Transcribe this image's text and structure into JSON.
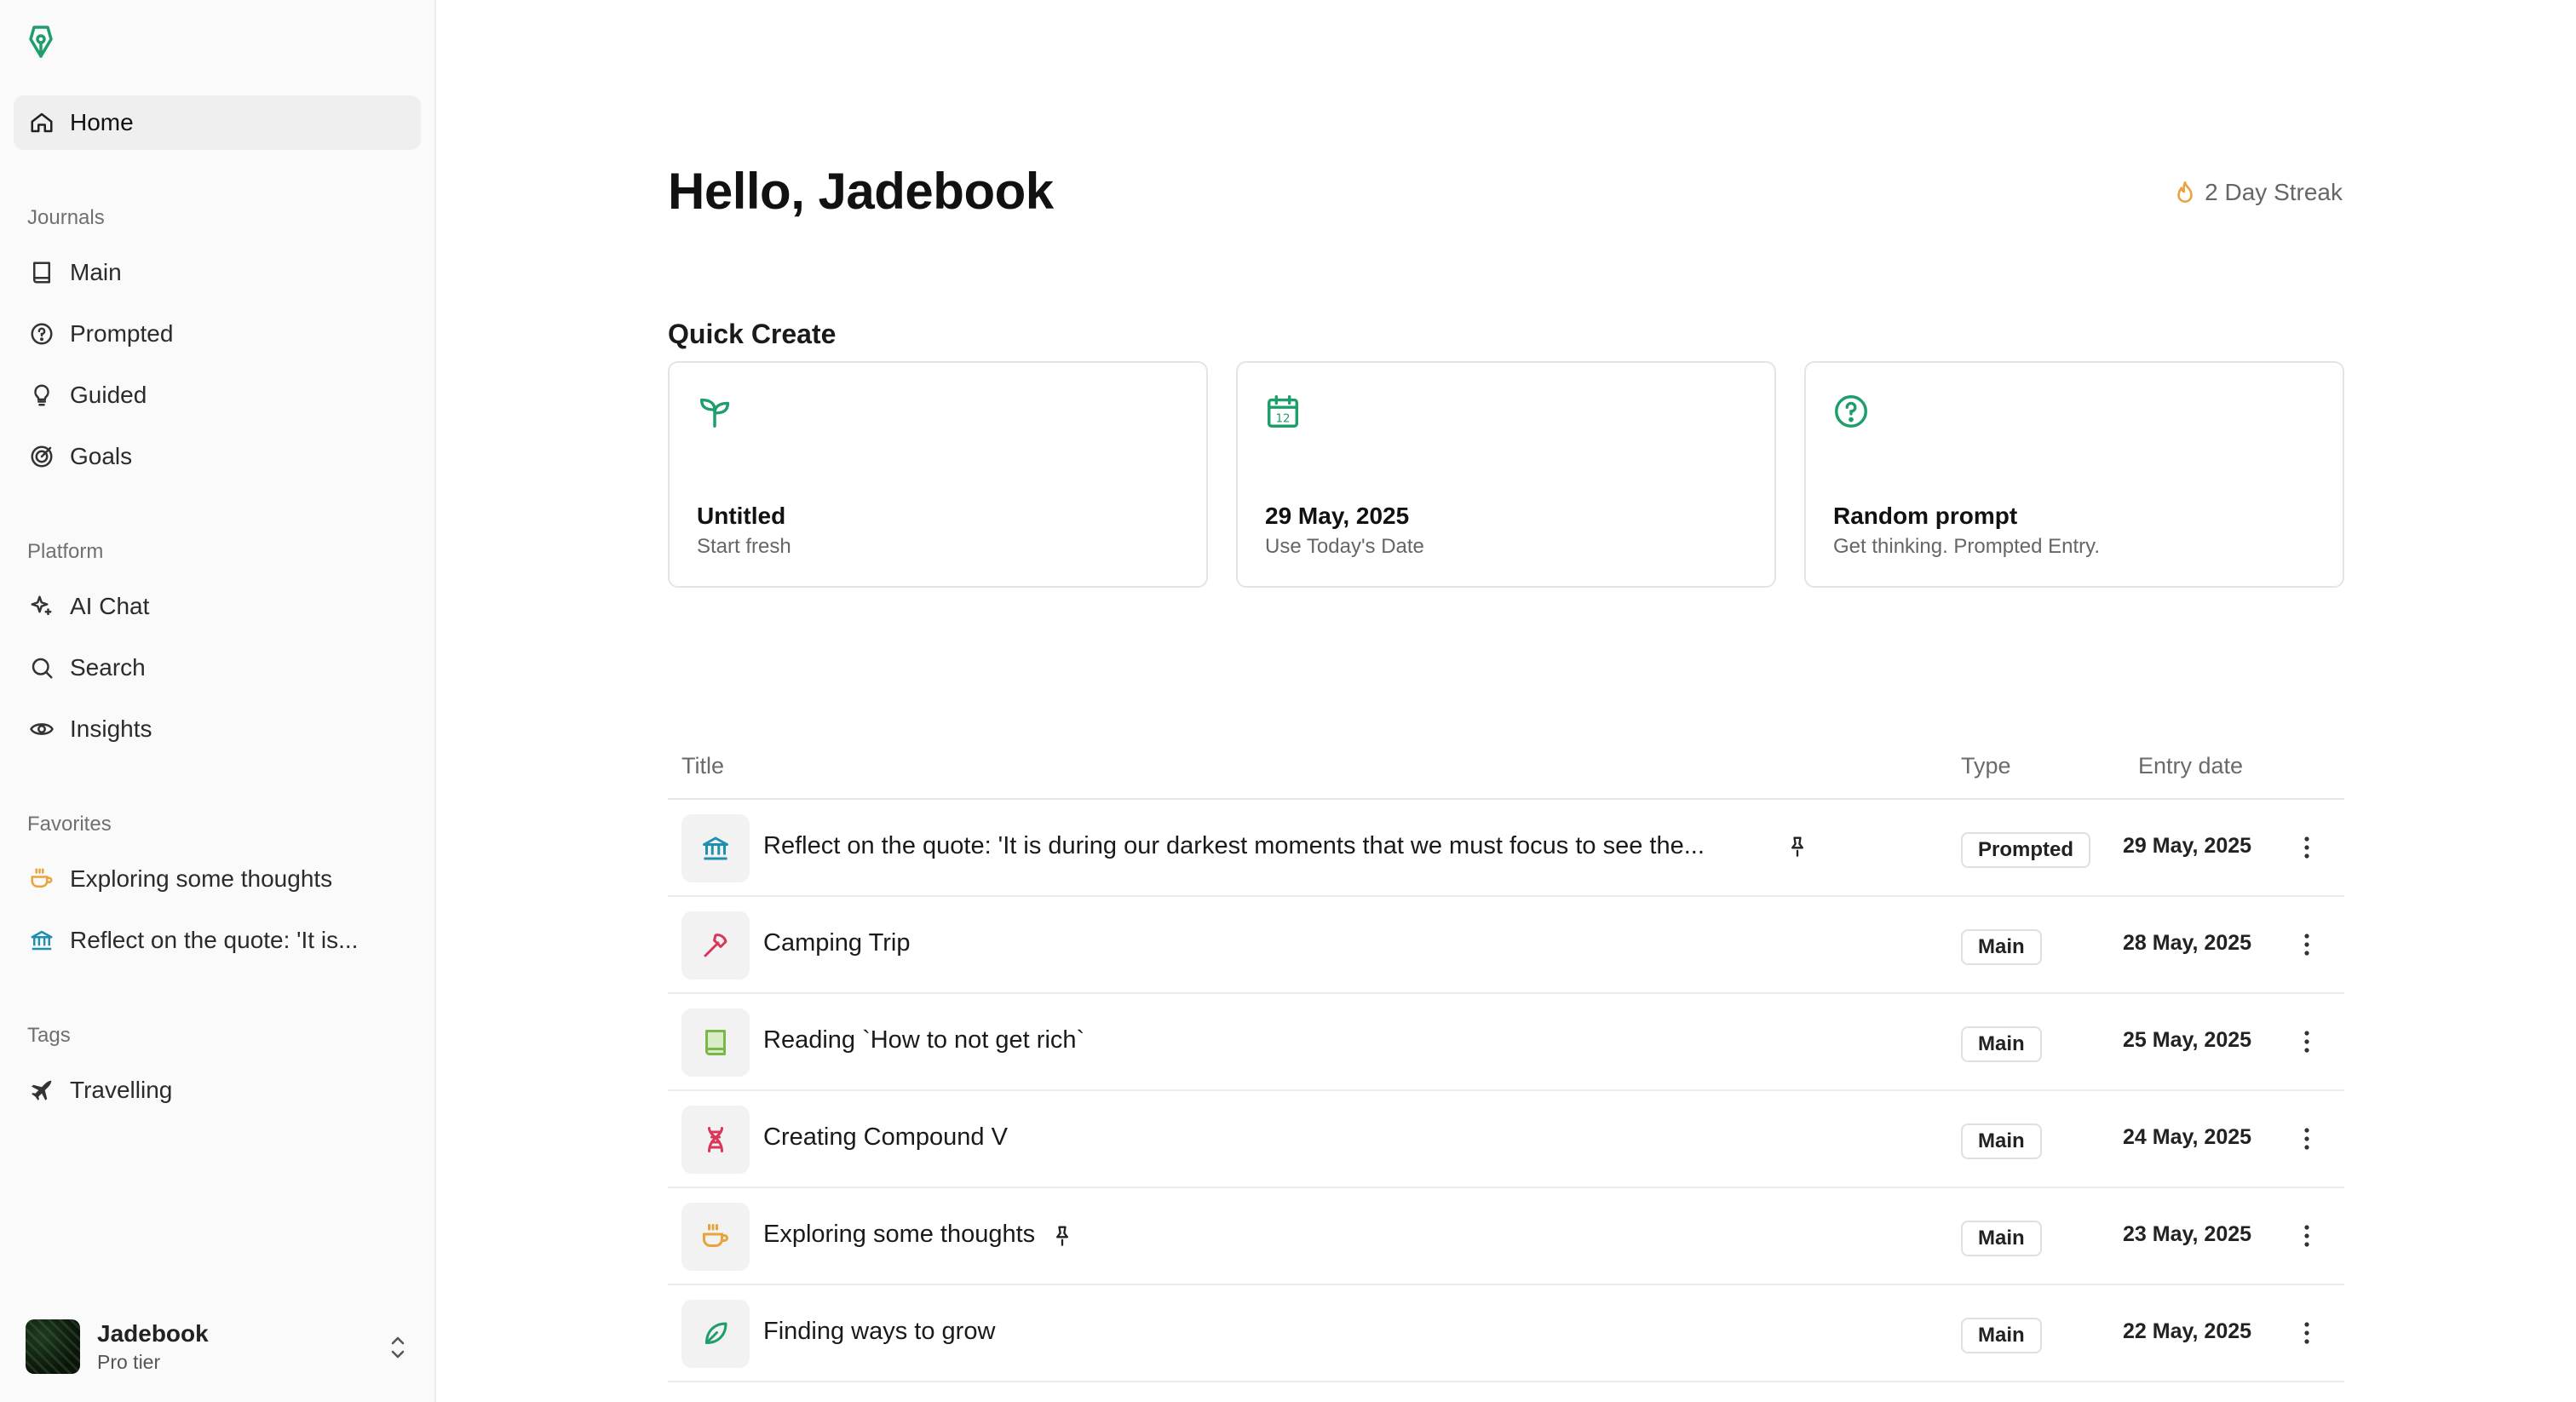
{
  "sidebar": {
    "home_label": "Home",
    "journals": {
      "section_label": "Journals",
      "items": [
        {
          "label": "Main",
          "icon": "book-icon"
        },
        {
          "label": "Prompted",
          "icon": "help-circle-icon"
        },
        {
          "label": "Guided",
          "icon": "lightbulb-icon"
        },
        {
          "label": "Goals",
          "icon": "target-icon"
        }
      ]
    },
    "platform": {
      "section_label": "Platform",
      "items": [
        {
          "label": "AI Chat",
          "icon": "sparkles-icon"
        },
        {
          "label": "Search",
          "icon": "search-icon"
        },
        {
          "label": "Insights",
          "icon": "eye-icon"
        }
      ]
    },
    "favorites": {
      "section_label": "Favorites",
      "items": [
        {
          "label": "Exploring some thoughts",
          "icon": "coffee-icon"
        },
        {
          "label": "Reflect on the quote: 'It is...",
          "icon": "landmark-icon"
        }
      ]
    },
    "tags": {
      "section_label": "Tags",
      "items": [
        {
          "label": "Travelling",
          "icon": "plane-icon"
        }
      ]
    },
    "user": {
      "name": "Jadebook",
      "tier": "Pro tier"
    }
  },
  "main": {
    "greeting": "Hello, Jadebook",
    "streak_label": "2 Day Streak",
    "quick_create": {
      "title": "Quick Create",
      "cards": [
        {
          "title": "Untitled",
          "subtitle": "Start fresh",
          "icon": "sprout-icon"
        },
        {
          "title": "29 May, 2025",
          "subtitle": "Use Today's Date",
          "icon": "calendar-icon",
          "icon_text": "12"
        },
        {
          "title": "Random prompt",
          "subtitle": "Get thinking. Prompted Entry.",
          "icon": "help-circle-icon"
        }
      ]
    },
    "table": {
      "headers": {
        "title": "Title",
        "type": "Type",
        "date": "Entry date"
      },
      "rows": [
        {
          "title": "Reflect on the quote: 'It is during our darkest moments that we must focus to see the...",
          "type": "Prompted",
          "date": "29 May, 2025",
          "icon": "landmark-icon",
          "pinned": true
        },
        {
          "title": "Camping Trip",
          "type": "Main",
          "date": "28 May, 2025",
          "icon": "axe-icon",
          "pinned": false
        },
        {
          "title": "Reading `How to not get rich`",
          "type": "Main",
          "date": "25 May, 2025",
          "icon": "book-icon",
          "pinned": false
        },
        {
          "title": "Creating Compound V",
          "type": "Main",
          "date": "24 May, 2025",
          "icon": "dna-icon",
          "pinned": false
        },
        {
          "title": "Exploring some thoughts",
          "type": "Main",
          "date": "23 May, 2025",
          "icon": "coffee-icon",
          "pinned": true
        },
        {
          "title": "Finding ways to grow",
          "type": "Main",
          "date": "22 May, 2025",
          "icon": "leaf-icon",
          "pinned": false
        }
      ]
    }
  },
  "colors": {
    "brand_green": "#1f9d6b",
    "accent_orange": "#e8a33b",
    "accent_red": "#d9365a",
    "accent_lime": "#7ab648"
  }
}
